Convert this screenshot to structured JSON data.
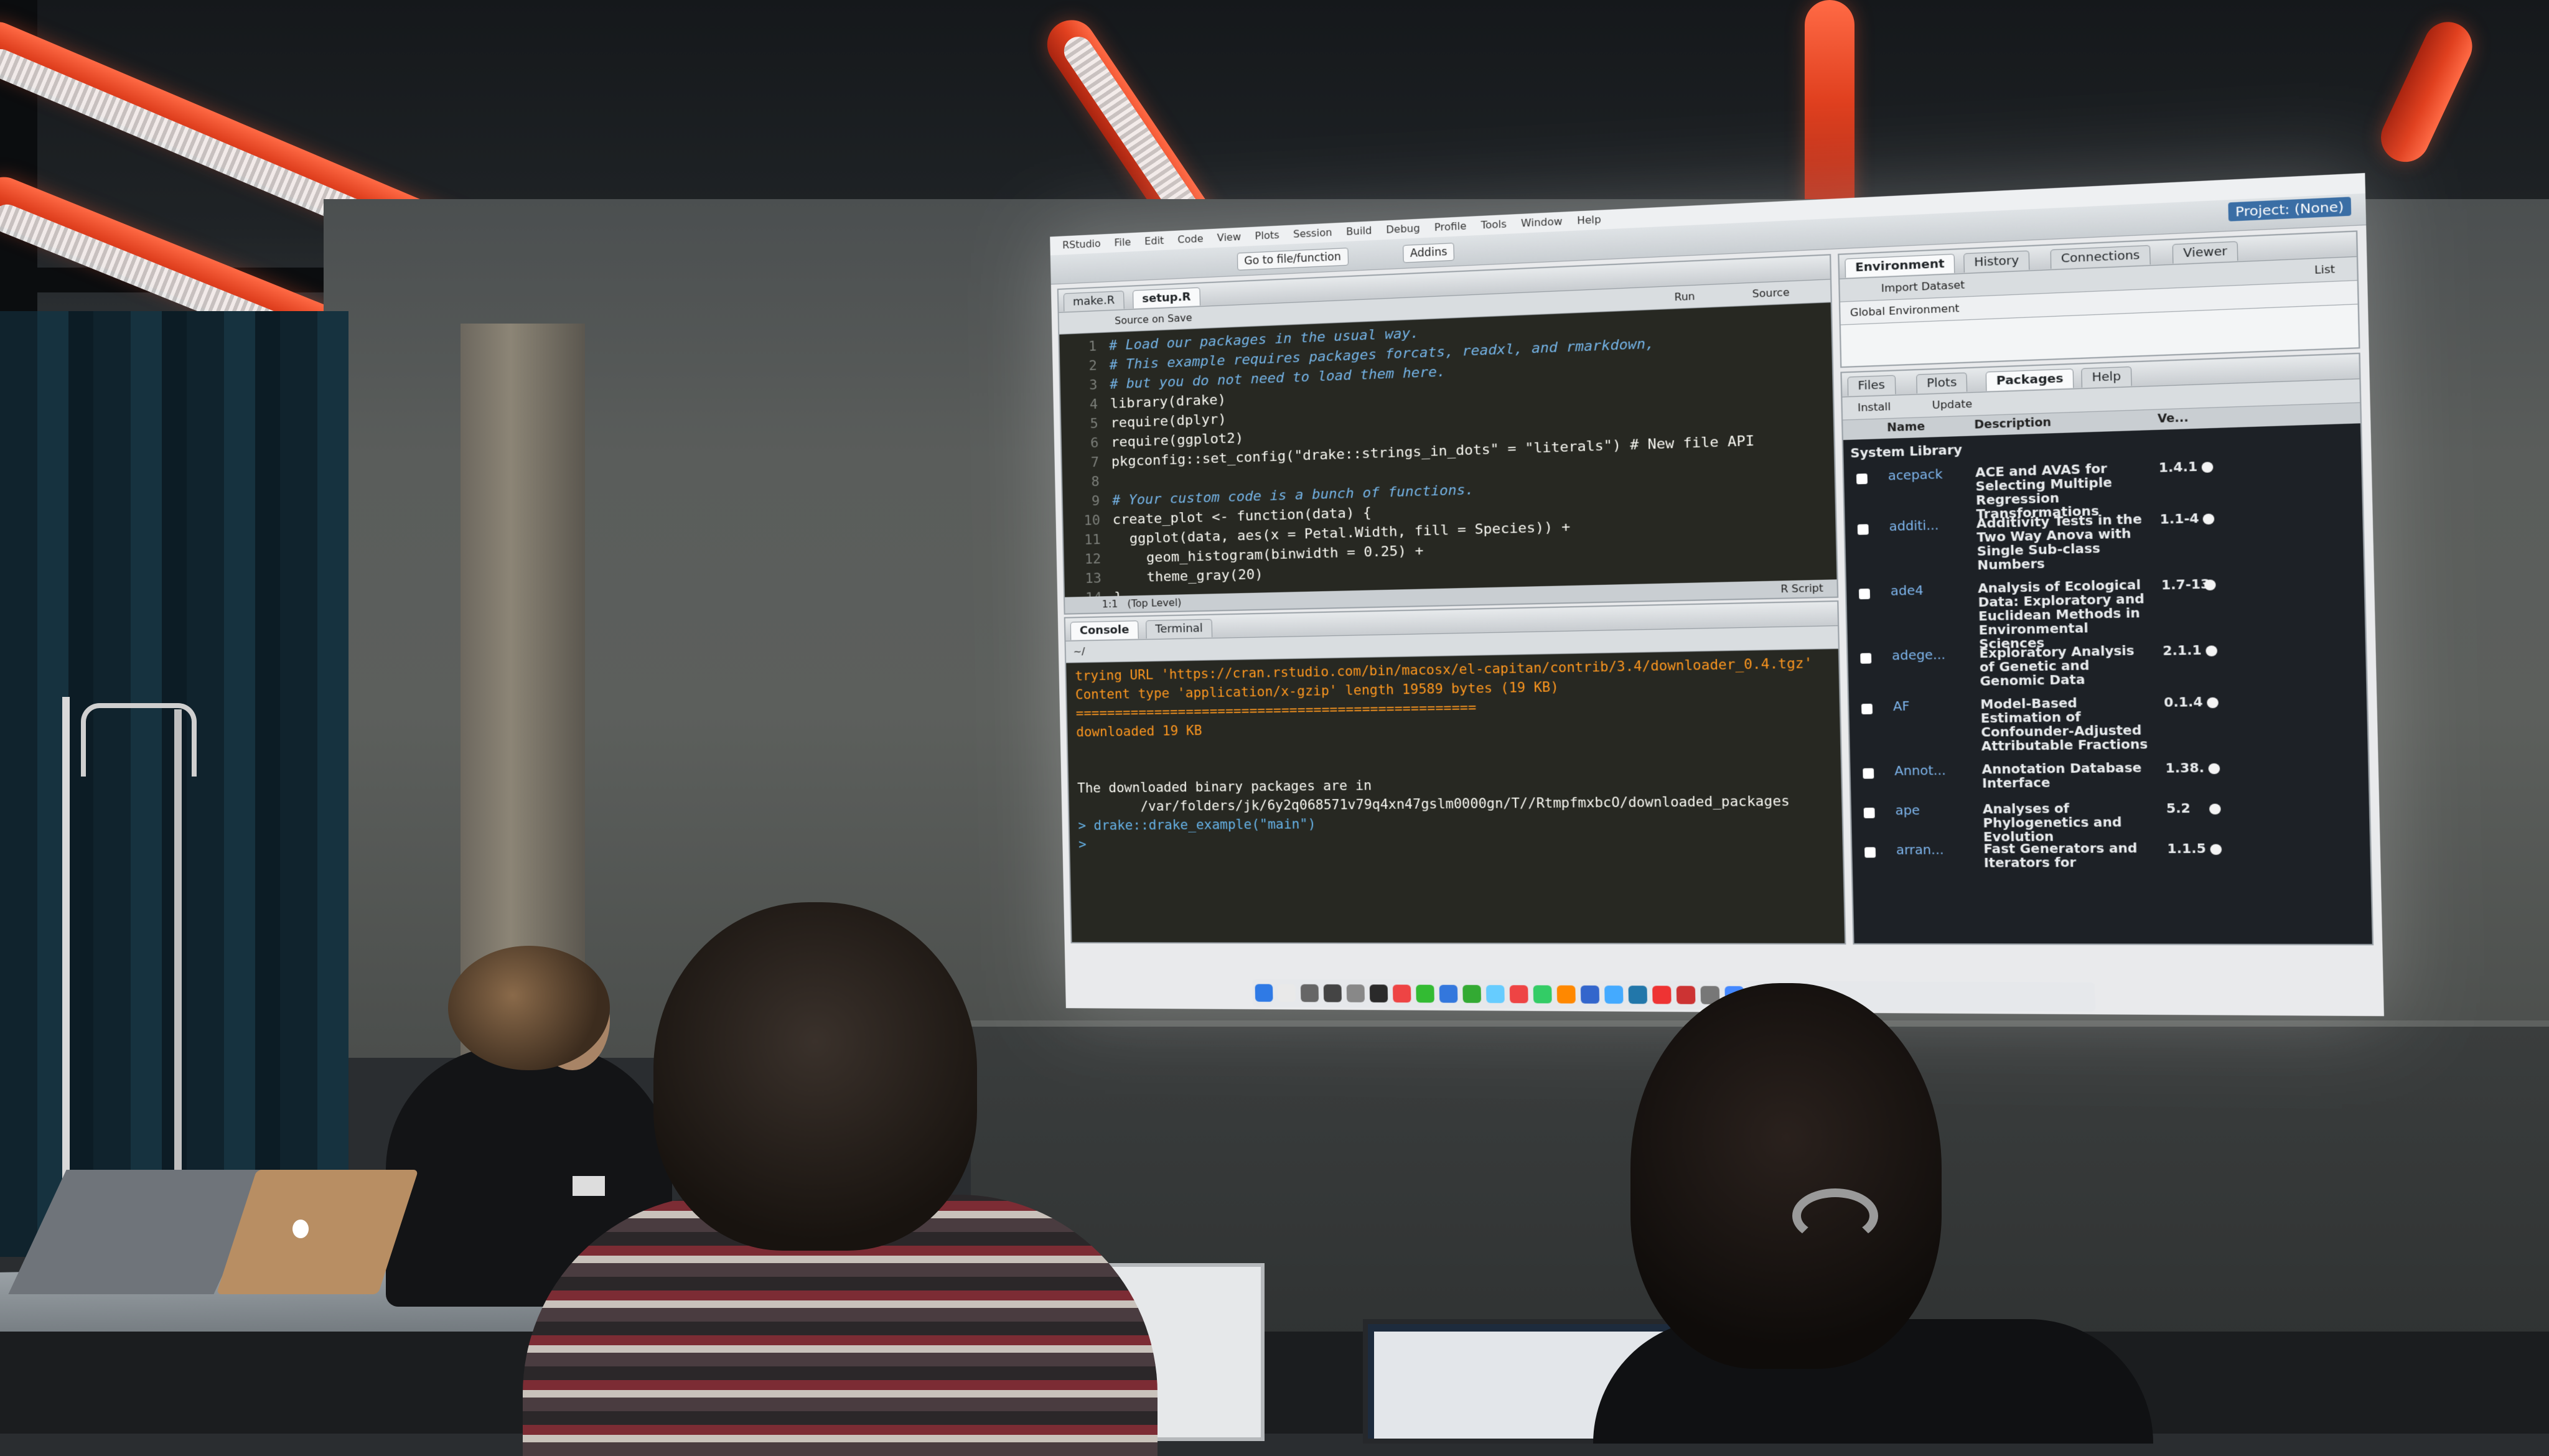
{
  "rstudio": {
    "mac_menu": [
      "RStudio",
      "File",
      "Edit",
      "Code",
      "View",
      "Plots",
      "Session",
      "Build",
      "Debug",
      "Profile",
      "Tools",
      "Window",
      "Help"
    ],
    "toolbar": {
      "go_to": "Go to file/function",
      "addins": "Addins",
      "project": "Project: (None)"
    },
    "editor": {
      "tabs": [
        "make.R",
        "setup.R"
      ],
      "source_on_save": "Source on Save",
      "run_button": "Run",
      "source_button": "Source",
      "lines": [
        {
          "n": "1",
          "text": "# Load our packages in the usual way.",
          "type": "comment"
        },
        {
          "n": "2",
          "text": "# This example requires packages forcats, readxl, and rmarkdown,",
          "type": "comment"
        },
        {
          "n": "3",
          "text": "# but you do not need to load them here.",
          "type": "comment"
        },
        {
          "n": "4",
          "text": "library(drake)",
          "type": "code"
        },
        {
          "n": "5",
          "text": "require(dplyr)",
          "type": "code"
        },
        {
          "n": "6",
          "text": "require(ggplot2)",
          "type": "code"
        },
        {
          "n": "7",
          "text": "pkgconfig::set_config(\"drake::strings_in_dots\" = \"literals\") # New file API",
          "type": "code"
        },
        {
          "n": "8",
          "text": "",
          "type": "code"
        },
        {
          "n": "9",
          "text": "# Your custom code is a bunch of functions.",
          "type": "comment"
        },
        {
          "n": "10",
          "text": "create_plot <- function(data) {",
          "type": "code"
        },
        {
          "n": "11",
          "text": "  ggplot(data, aes(x = Petal.Width, fill = Species)) +",
          "type": "code"
        },
        {
          "n": "12",
          "text": "    geom_histogram(binwidth = 0.25) +",
          "type": "code"
        },
        {
          "n": "13",
          "text": "    theme_gray(20)",
          "type": "code"
        },
        {
          "n": "14",
          "text": "}",
          "type": "code"
        }
      ],
      "status_position": "1:1",
      "status_scope": "(Top Level)",
      "status_type": "R Script"
    },
    "console": {
      "tabs": [
        "Console",
        "Terminal"
      ],
      "path": "~/",
      "lines": [
        {
          "text": "trying URL 'https://cran.rstudio.com/bin/macosx/el-capitan/contrib/3.4/downloader_0.4.tgz'",
          "color": "orange"
        },
        {
          "text": "Content type 'application/x-gzip' length 19589 bytes (19 KB)",
          "color": "orange"
        },
        {
          "text": "==================================================",
          "color": "orange"
        },
        {
          "text": "downloaded 19 KB",
          "color": "orange"
        },
        {
          "text": "",
          "color": "white"
        },
        {
          "text": "",
          "color": "white"
        },
        {
          "text": "The downloaded binary packages are in",
          "color": "white"
        },
        {
          "text": "        /var/folders/jk/6y2q068571v79q4xn47gslm0000gn/T//RtmpfmxbcO/downloaded_packages",
          "color": "white"
        },
        {
          "text": "> drake::drake_example(\"main\")",
          "color": "blue"
        },
        {
          "text": ">",
          "color": "blue"
        }
      ]
    },
    "environment": {
      "tabs": [
        "Environment",
        "History",
        "Connections",
        "Viewer"
      ],
      "import_dataset": "Import Dataset",
      "list_label": "List",
      "scope": "Global Environment"
    },
    "packages": {
      "tabs": [
        "Files",
        "Plots",
        "Packages",
        "Help"
      ],
      "install": "Install",
      "update": "Update",
      "col_name": "Name",
      "col_description": "Description",
      "col_version": "Ve...",
      "section": "System Library",
      "rows": [
        {
          "name": "acepack",
          "description": "ACE and AVAS for Selecting Multiple Regression Transformations",
          "version": "1.4.1"
        },
        {
          "name": "additi...",
          "description": "Additivity Tests in the Two Way Anova with Single Sub-class Numbers",
          "version": "1.1-4"
        },
        {
          "name": "ade4",
          "description": "Analysis of Ecological Data: Exploratory and Euclidean Methods in Environmental Sciences",
          "version": "1.7-13"
        },
        {
          "name": "adege...",
          "description": "Exploratory Analysis of Genetic and Genomic Data",
          "version": "2.1.1"
        },
        {
          "name": "AF",
          "description": "Model-Based Estimation of Confounder-Adjusted Attributable Fractions",
          "version": "0.1.4"
        },
        {
          "name": "Annot...",
          "description": "Annotation Database Interface",
          "version": "1.38."
        },
        {
          "name": "ape",
          "description": "Analyses of Phylogenetics and Evolution",
          "version": "5.2"
        },
        {
          "name": "arran...",
          "description": "Fast Generators and Iterators for",
          "version": "1.1.5"
        }
      ]
    },
    "dock_colors": [
      "#2f7ae5",
      "#e9e9e9",
      "#666",
      "#444",
      "#888",
      "#2a2a2a",
      "#e44",
      "#3b3",
      "#37d",
      "#3a3",
      "#6cf",
      "#e44",
      "#3c6",
      "#f80",
      "#36c",
      "#4af",
      "#27a",
      "#e33",
      "#c33",
      "#777",
      "#48f",
      "#aaa",
      "#9cf"
    ]
  }
}
